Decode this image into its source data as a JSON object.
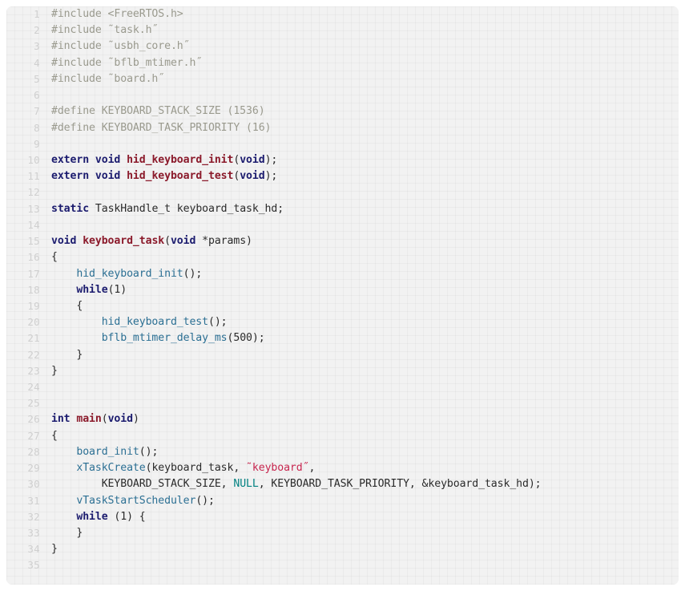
{
  "document": {
    "type": "source-code-listing",
    "language": "c",
    "total_lines": 35,
    "first_line_number": 1,
    "theme": {
      "panel_background": "#f2f2f2",
      "page_background": "#ffffff",
      "grid_line": "rgba(0,0,0,0.030)",
      "gutter_text": "#cfcfcf",
      "default_text": "#2a2a2a",
      "preprocessor": "#9a9a8e",
      "keyword": "#1b1b6e",
      "definition": "#8b1a2b",
      "function_call": "#2b6f93",
      "string": "#c7254e",
      "constant": "#008080"
    }
  },
  "lines": [
    {
      "n": "1",
      "tokens": [
        {
          "t": "#include <FreeRTOS.h>",
          "c": "tok-pre"
        }
      ]
    },
    {
      "n": "2",
      "tokens": [
        {
          "t": "#include ˜task.h˝",
          "c": "tok-pre"
        }
      ]
    },
    {
      "n": "3",
      "tokens": [
        {
          "t": "#include ˜usbh_core.h˝",
          "c": "tok-pre"
        }
      ]
    },
    {
      "n": "4",
      "tokens": [
        {
          "t": "#include ˜bflb_mtimer.h˝",
          "c": "tok-pre"
        }
      ]
    },
    {
      "n": "5",
      "tokens": [
        {
          "t": "#include ˜board.h˝",
          "c": "tok-pre"
        }
      ]
    },
    {
      "n": "6",
      "tokens": []
    },
    {
      "n": "7",
      "tokens": [
        {
          "t": "#define KEYBOARD_STACK_SIZE (1536)",
          "c": "tok-pre"
        }
      ]
    },
    {
      "n": "8",
      "tokens": [
        {
          "t": "#define KEYBOARD_TASK_PRIORITY (16)",
          "c": "tok-pre"
        }
      ]
    },
    {
      "n": "9",
      "tokens": []
    },
    {
      "n": "10",
      "tokens": [
        {
          "t": "extern",
          "c": "tok-kw"
        },
        {
          "t": " ",
          "c": "tok-plain"
        },
        {
          "t": "void",
          "c": "tok-kw"
        },
        {
          "t": " ",
          "c": "tok-plain"
        },
        {
          "t": "hid_keyboard_init",
          "c": "tok-def"
        },
        {
          "t": "(",
          "c": "tok-punct"
        },
        {
          "t": "void",
          "c": "tok-kw"
        },
        {
          "t": ");",
          "c": "tok-punct"
        }
      ]
    },
    {
      "n": "11",
      "tokens": [
        {
          "t": "extern",
          "c": "tok-kw"
        },
        {
          "t": " ",
          "c": "tok-plain"
        },
        {
          "t": "void",
          "c": "tok-kw"
        },
        {
          "t": " ",
          "c": "tok-plain"
        },
        {
          "t": "hid_keyboard_test",
          "c": "tok-def"
        },
        {
          "t": "(",
          "c": "tok-punct"
        },
        {
          "t": "void",
          "c": "tok-kw"
        },
        {
          "t": ");",
          "c": "tok-punct"
        }
      ]
    },
    {
      "n": "12",
      "tokens": []
    },
    {
      "n": "13",
      "tokens": [
        {
          "t": "static",
          "c": "tok-kw"
        },
        {
          "t": " TaskHandle_t keyboard_task_hd;",
          "c": "tok-plain"
        }
      ]
    },
    {
      "n": "14",
      "tokens": []
    },
    {
      "n": "15",
      "tokens": [
        {
          "t": "void",
          "c": "tok-kw"
        },
        {
          "t": " ",
          "c": "tok-plain"
        },
        {
          "t": "keyboard_task",
          "c": "tok-def"
        },
        {
          "t": "(",
          "c": "tok-punct"
        },
        {
          "t": "void",
          "c": "tok-kw"
        },
        {
          "t": " *params)",
          "c": "tok-plain"
        }
      ]
    },
    {
      "n": "16",
      "tokens": [
        {
          "t": "{",
          "c": "tok-punct"
        }
      ]
    },
    {
      "n": "17",
      "tokens": [
        {
          "t": "    ",
          "c": "tok-plain"
        },
        {
          "t": "hid_keyboard_init",
          "c": "tok-call"
        },
        {
          "t": "();",
          "c": "tok-punct"
        }
      ]
    },
    {
      "n": "18",
      "tokens": [
        {
          "t": "    ",
          "c": "tok-plain"
        },
        {
          "t": "while",
          "c": "tok-kw"
        },
        {
          "t": "(",
          "c": "tok-punct"
        },
        {
          "t": "1",
          "c": "tok-num"
        },
        {
          "t": ")",
          "c": "tok-punct"
        }
      ]
    },
    {
      "n": "19",
      "tokens": [
        {
          "t": "    {",
          "c": "tok-punct"
        }
      ]
    },
    {
      "n": "20",
      "tokens": [
        {
          "t": "        ",
          "c": "tok-plain"
        },
        {
          "t": "hid_keyboard_test",
          "c": "tok-call"
        },
        {
          "t": "();",
          "c": "tok-punct"
        }
      ]
    },
    {
      "n": "21",
      "tokens": [
        {
          "t": "        ",
          "c": "tok-plain"
        },
        {
          "t": "bflb_mtimer_delay_ms",
          "c": "tok-call"
        },
        {
          "t": "(",
          "c": "tok-punct"
        },
        {
          "t": "500",
          "c": "tok-num"
        },
        {
          "t": ");",
          "c": "tok-punct"
        }
      ]
    },
    {
      "n": "22",
      "tokens": [
        {
          "t": "    }",
          "c": "tok-punct"
        }
      ]
    },
    {
      "n": "23",
      "tokens": [
        {
          "t": "}",
          "c": "tok-punct"
        }
      ]
    },
    {
      "n": "24",
      "tokens": []
    },
    {
      "n": "25",
      "tokens": []
    },
    {
      "n": "26",
      "tokens": [
        {
          "t": "int",
          "c": "tok-kw"
        },
        {
          "t": " ",
          "c": "tok-plain"
        },
        {
          "t": "main",
          "c": "tok-def"
        },
        {
          "t": "(",
          "c": "tok-punct"
        },
        {
          "t": "void",
          "c": "tok-kw"
        },
        {
          "t": ")",
          "c": "tok-punct"
        }
      ]
    },
    {
      "n": "27",
      "tokens": [
        {
          "t": "{",
          "c": "tok-punct"
        }
      ]
    },
    {
      "n": "28",
      "tokens": [
        {
          "t": "    ",
          "c": "tok-plain"
        },
        {
          "t": "board_init",
          "c": "tok-call"
        },
        {
          "t": "();",
          "c": "tok-punct"
        }
      ]
    },
    {
      "n": "29",
      "tokens": [
        {
          "t": "    ",
          "c": "tok-plain"
        },
        {
          "t": "xTaskCreate",
          "c": "tok-call"
        },
        {
          "t": "(keyboard_task, ",
          "c": "tok-plain"
        },
        {
          "t": "˜keyboard˝",
          "c": "tok-str"
        },
        {
          "t": ",",
          "c": "tok-punct"
        }
      ]
    },
    {
      "n": "30",
      "tokens": [
        {
          "t": "        KEYBOARD_STACK_SIZE, ",
          "c": "tok-plain"
        },
        {
          "t": "NULL",
          "c": "tok-const"
        },
        {
          "t": ", KEYBOARD_TASK_PRIORITY, &keyboard_task_hd);",
          "c": "tok-plain"
        }
      ]
    },
    {
      "n": "31",
      "tokens": [
        {
          "t": "    ",
          "c": "tok-plain"
        },
        {
          "t": "vTaskStartScheduler",
          "c": "tok-call"
        },
        {
          "t": "();",
          "c": "tok-punct"
        }
      ]
    },
    {
      "n": "32",
      "tokens": [
        {
          "t": "    ",
          "c": "tok-plain"
        },
        {
          "t": "while",
          "c": "tok-kw"
        },
        {
          "t": " (",
          "c": "tok-punct"
        },
        {
          "t": "1",
          "c": "tok-num"
        },
        {
          "t": ") {",
          "c": "tok-punct"
        }
      ]
    },
    {
      "n": "33",
      "tokens": [
        {
          "t": "    }",
          "c": "tok-punct"
        }
      ]
    },
    {
      "n": "34",
      "tokens": [
        {
          "t": "}",
          "c": "tok-punct"
        }
      ]
    },
    {
      "n": "35",
      "tokens": []
    }
  ]
}
